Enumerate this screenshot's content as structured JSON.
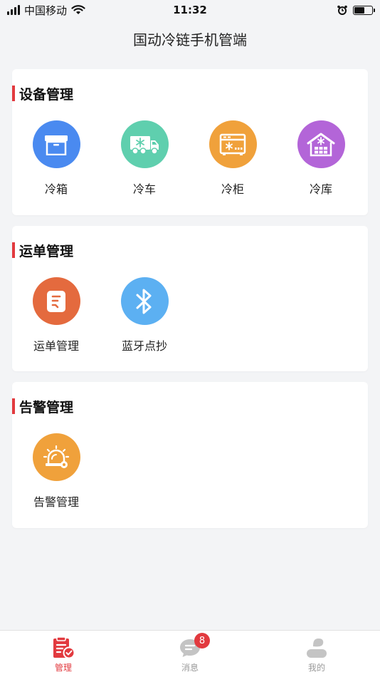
{
  "status_bar": {
    "carrier": "中国移动",
    "time": "11:32"
  },
  "header": {
    "title": "国动冷链手机管端"
  },
  "sections": [
    {
      "title": "设备管理",
      "items": [
        {
          "label": "冷箱",
          "icon": "box-icon",
          "color": "#4a8af0"
        },
        {
          "label": "冷车",
          "icon": "truck-icon",
          "color": "#5fcfae"
        },
        {
          "label": "冷柜",
          "icon": "freezer-icon",
          "color": "#f0a13b"
        },
        {
          "label": "冷库",
          "icon": "warehouse-icon",
          "color": "#b365d8"
        }
      ]
    },
    {
      "title": "运单管理",
      "items": [
        {
          "label": "运单管理",
          "icon": "waybill-icon",
          "color": "#e46a3e"
        },
        {
          "label": "蓝牙点抄",
          "icon": "bluetooth-icon",
          "color": "#5cb0f2"
        }
      ]
    },
    {
      "title": "告警管理",
      "items": [
        {
          "label": "告警管理",
          "icon": "alarm-icon",
          "color": "#f0a13b"
        }
      ]
    }
  ],
  "tab_bar": {
    "tabs": [
      {
        "label": "管理",
        "icon": "manage-icon",
        "active": true
      },
      {
        "label": "消息",
        "icon": "message-icon",
        "badge": "8"
      },
      {
        "label": "我的",
        "icon": "profile-icon"
      }
    ]
  },
  "colors": {
    "accent": "#e23a3f",
    "background": "#f3f4f6"
  }
}
